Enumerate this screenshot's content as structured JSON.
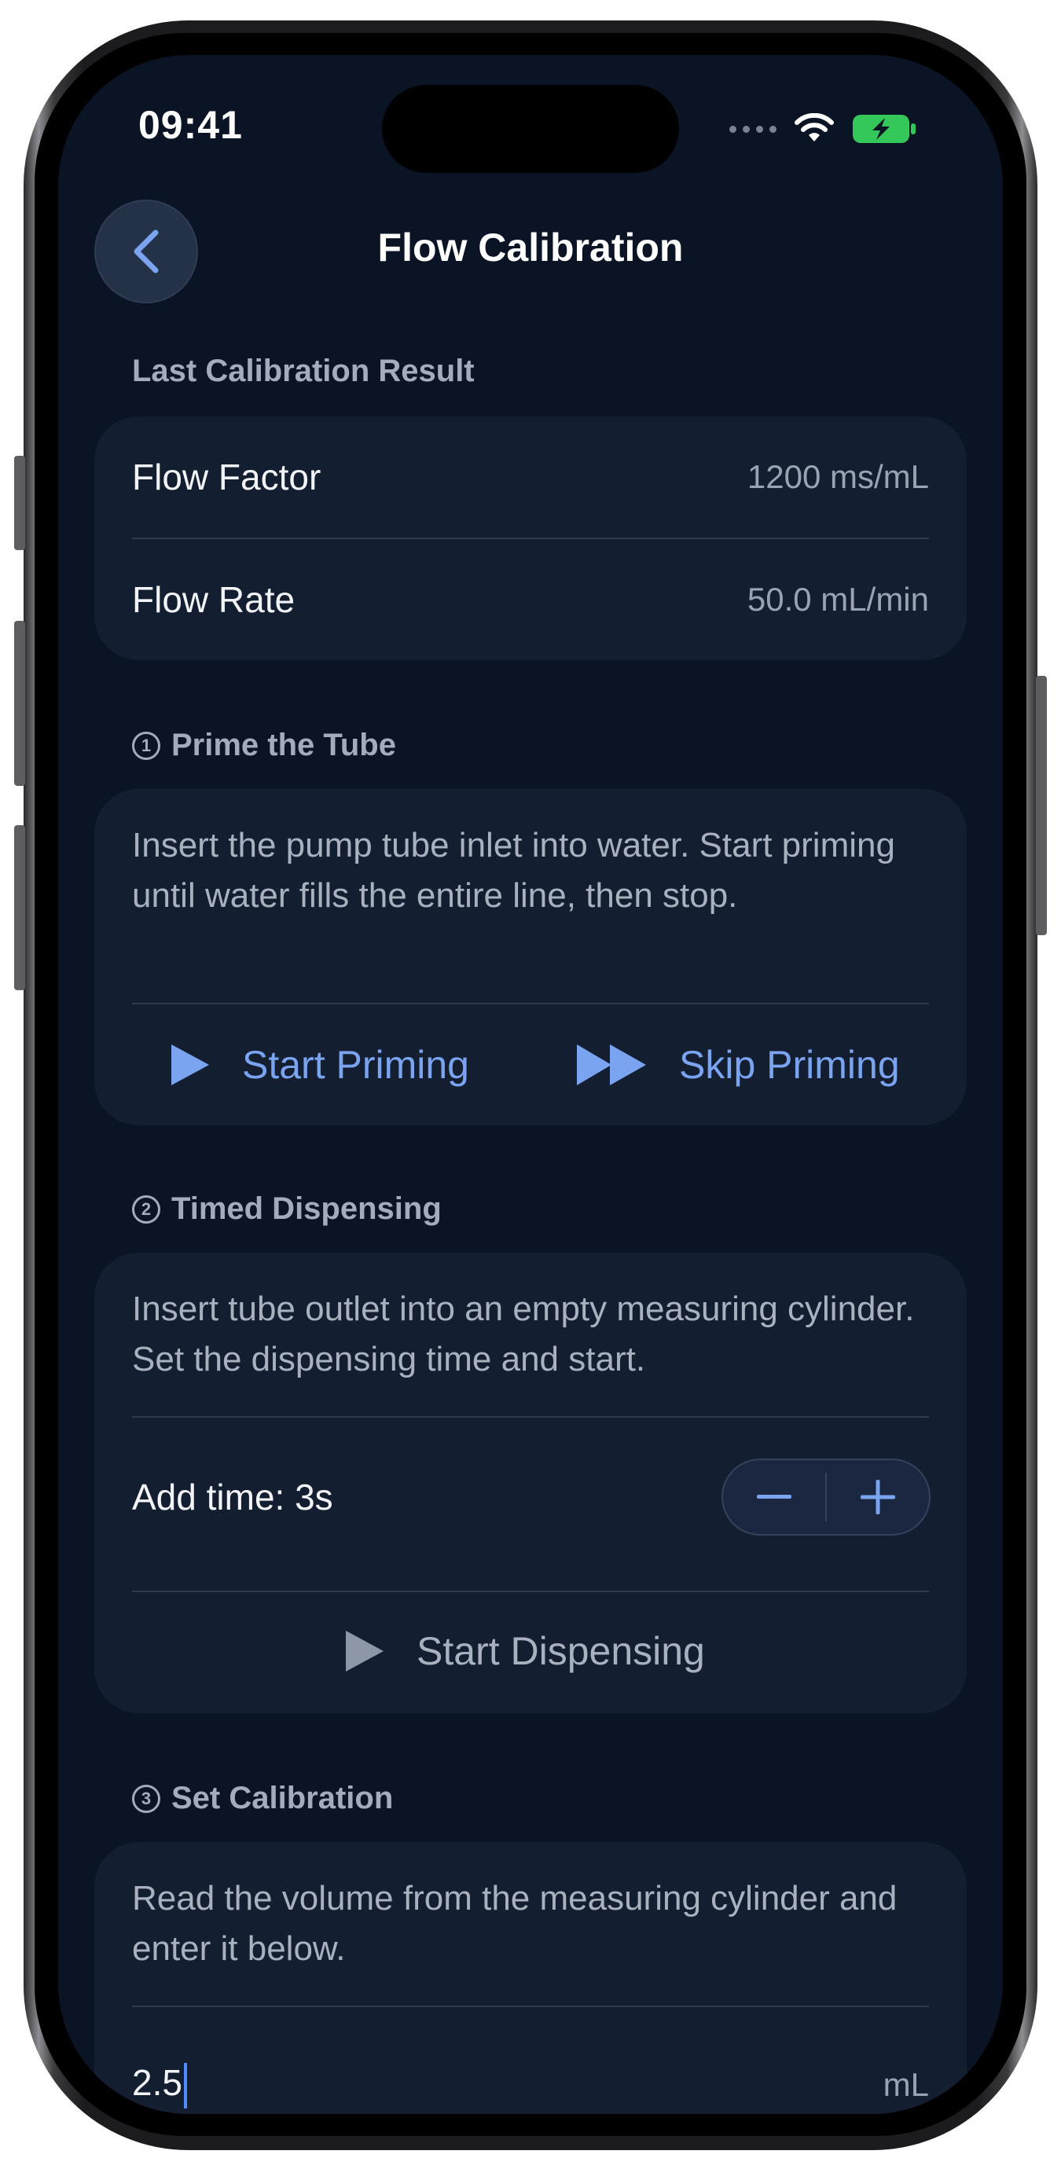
{
  "status_bar": {
    "time": "09:41"
  },
  "header": {
    "title": "Flow Calibration"
  },
  "last_result": {
    "section_label": "Last Calibration Result",
    "rows": [
      {
        "label": "Flow Factor",
        "value": "1200 ms/mL"
      },
      {
        "label": "Flow Rate",
        "value": "50.0 mL/min"
      }
    ]
  },
  "step1": {
    "number": "1",
    "section_label": "Prime the Tube",
    "description": "Insert the pump tube inlet into water. Start priming until water fills the entire line, then stop.",
    "start_label": "Start Priming",
    "skip_label": "Skip Priming"
  },
  "step2": {
    "number": "2",
    "section_label": "Timed Dispensing",
    "description": "Insert tube outlet into an empty measuring cylinder. Set the dispensing time and start.",
    "add_time_label": "Add time: 3s",
    "start_label": "Start Dispensing"
  },
  "step3": {
    "number": "3",
    "section_label": "Set Calibration",
    "description": "Read the volume from the measuring cylinder and enter it below.",
    "volume_value": "2.5",
    "unit": "mL"
  },
  "colors": {
    "accent": "#7aa3f0",
    "battery": "#34c759",
    "background": "#0b1424"
  }
}
